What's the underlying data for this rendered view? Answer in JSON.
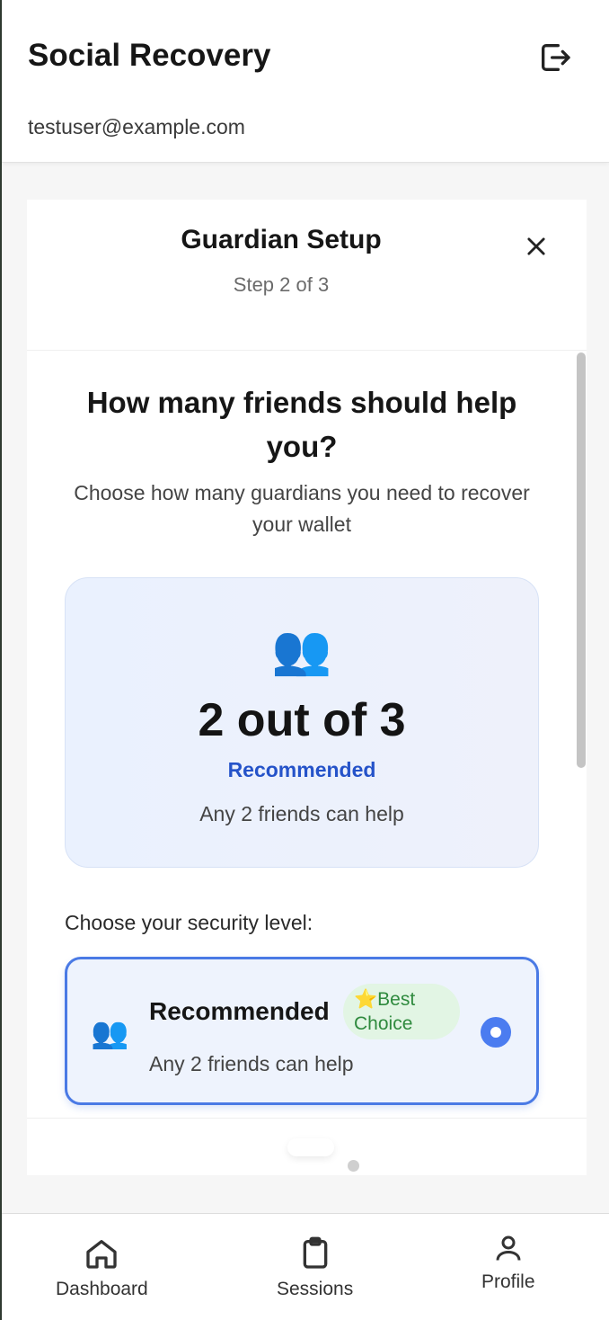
{
  "header": {
    "title": "Social Recovery",
    "email": "testuser@example.com",
    "logout_icon": "logout-icon"
  },
  "modal": {
    "title": "Guardian Setup",
    "step": "Step 2 of 3",
    "close_icon": "close-icon",
    "question": "How many friends should help you?",
    "subtitle": "Choose how many guardians you need to recover your wallet",
    "summary": {
      "icon": "👥",
      "value": "2 out of 3",
      "tag": "Recommended",
      "description": "Any 2 friends can help"
    },
    "section_label": "Choose your security level:",
    "options": [
      {
        "icon": "👥",
        "title": "Recommended",
        "badge_icon": "⭐",
        "badge_line1": "Best",
        "badge_line2": "Choice",
        "description": "Any 2 friends can help",
        "selected": true
      }
    ],
    "pager": {
      "total": 2,
      "current": 1
    }
  },
  "nav": {
    "items": [
      {
        "label": "Dashboard",
        "icon": "home-icon"
      },
      {
        "label": "Sessions",
        "icon": "clipboard-icon"
      },
      {
        "label": "Profile",
        "icon": "user-icon"
      }
    ]
  },
  "colors": {
    "accent": "#4b7cf0",
    "recommended_text": "#2553c9",
    "badge_bg": "#e2f5e4",
    "badge_text": "#2f8a3e"
  }
}
